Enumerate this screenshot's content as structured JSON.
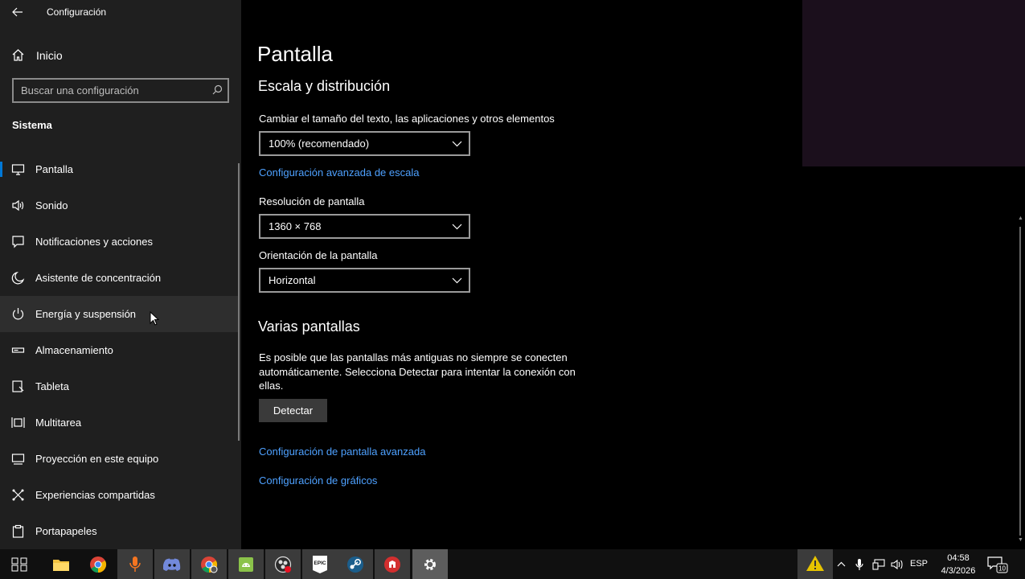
{
  "app": {
    "title": "Configuración"
  },
  "sidebar": {
    "home_label": "Inicio",
    "search_placeholder": "Buscar una configuración",
    "section": "Sistema",
    "items": [
      {
        "label": "Pantalla",
        "icon": "monitor-icon"
      },
      {
        "label": "Sonido",
        "icon": "speaker-icon"
      },
      {
        "label": "Notificaciones y acciones",
        "icon": "message-icon"
      },
      {
        "label": "Asistente de concentración",
        "icon": "moon-icon"
      },
      {
        "label": "Energía y suspensión",
        "icon": "power-icon"
      },
      {
        "label": "Almacenamiento",
        "icon": "storage-icon"
      },
      {
        "label": "Tableta",
        "icon": "tablet-icon"
      },
      {
        "label": "Multitarea",
        "icon": "multitask-icon"
      },
      {
        "label": "Proyección en este equipo",
        "icon": "projection-icon"
      },
      {
        "label": "Experiencias compartidas",
        "icon": "share-icon"
      },
      {
        "label": "Portapapeles",
        "icon": "clipboard-icon"
      }
    ],
    "selected": "Pantalla",
    "hovered": "Energía y suspensión"
  },
  "main": {
    "title": "Pantalla",
    "scale_section": "Escala y distribución",
    "text_size_label": "Cambiar el tamaño del texto, las aplicaciones y otros elementos",
    "text_size_value": "100% (recomendado)",
    "advanced_scale_link": "Configuración avanzada de escala",
    "resolution_label": "Resolución de pantalla",
    "resolution_value": "1360 × 768",
    "orientation_label": "Orientación de la pantalla",
    "orientation_value": "Horizontal",
    "multi_section": "Varias pantallas",
    "multi_desc": "Es posible que las pantallas más antiguas no siempre se conecten automáticamente. Selecciona Detectar para intentar la conexión con ellas.",
    "detect_button": "Detectar",
    "advanced_display_link": "Configuración de pantalla avanzada",
    "graphics_link": "Configuración de gráficos"
  },
  "taskbar": {
    "apps": [
      {
        "name": "task-view",
        "icon": "task-view-icon"
      },
      {
        "name": "file-explorer",
        "icon": "folder-icon"
      },
      {
        "name": "chrome",
        "icon": "chrome-icon"
      },
      {
        "name": "recorder",
        "icon": "microphone-app-icon"
      },
      {
        "name": "discord",
        "icon": "discord-icon"
      },
      {
        "name": "chrome-profile",
        "icon": "chrome-profile-icon"
      },
      {
        "name": "android-emulator",
        "icon": "android-icon"
      },
      {
        "name": "obs",
        "icon": "obs-icon"
      },
      {
        "name": "epic-games",
        "icon": "epic-games-icon",
        "text": "EPIC"
      },
      {
        "name": "steam",
        "icon": "steam-icon"
      },
      {
        "name": "app-red",
        "icon": "red-app-icon"
      },
      {
        "name": "settings",
        "icon": "gear-icon"
      }
    ],
    "language": "ESP",
    "time": "04:58",
    "date": "4/3/2026",
    "notifications_count": "10"
  }
}
